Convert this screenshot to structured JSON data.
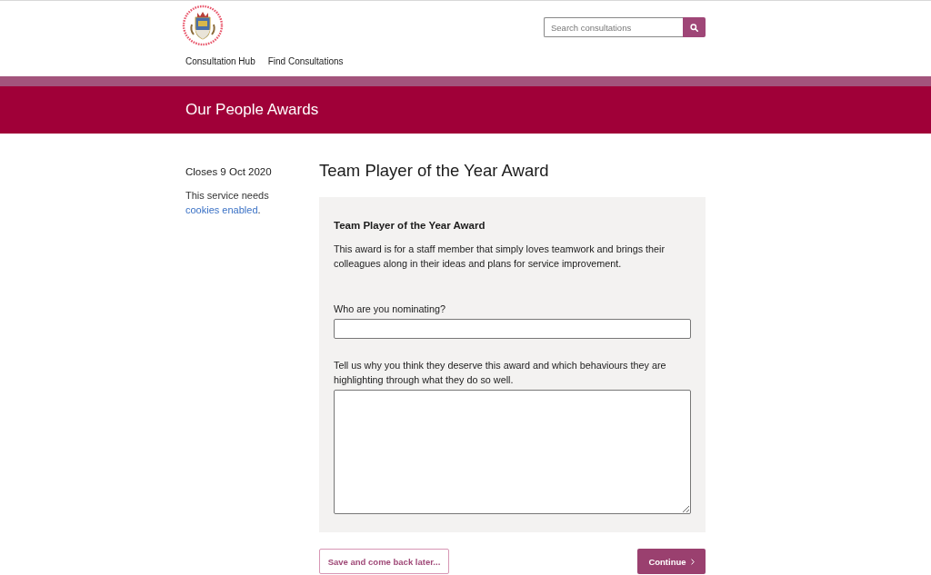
{
  "header": {
    "nav": [
      {
        "label": "Consultation Hub"
      },
      {
        "label": "Find Consultations"
      }
    ],
    "search": {
      "placeholder": "Search consultations"
    }
  },
  "banner": {
    "title": "Our People Awards"
  },
  "sidebar": {
    "closes": "Closes 9 Oct 2020",
    "cookie_note": {
      "text": "This service needs",
      "link": "cookies enabled",
      "tail": "."
    }
  },
  "page_title": "Team Player of the Year Award",
  "form": {
    "heading": "Team Player of the Year Award",
    "description": "This award is for a staff member that simply loves teamwork and brings their colleagues along in their ideas and plans for service improvement.",
    "fields": [
      {
        "kind": "text",
        "label": "Who are you nominating?"
      },
      {
        "kind": "textarea",
        "label": "Tell us why you think they deserve this award and which behaviours they are highlighting through what they do so well."
      }
    ]
  },
  "buttons": [
    {
      "kind": "secondary",
      "label": "Save and come back later..."
    },
    {
      "kind": "primary",
      "label": "Continue"
    }
  ]
}
